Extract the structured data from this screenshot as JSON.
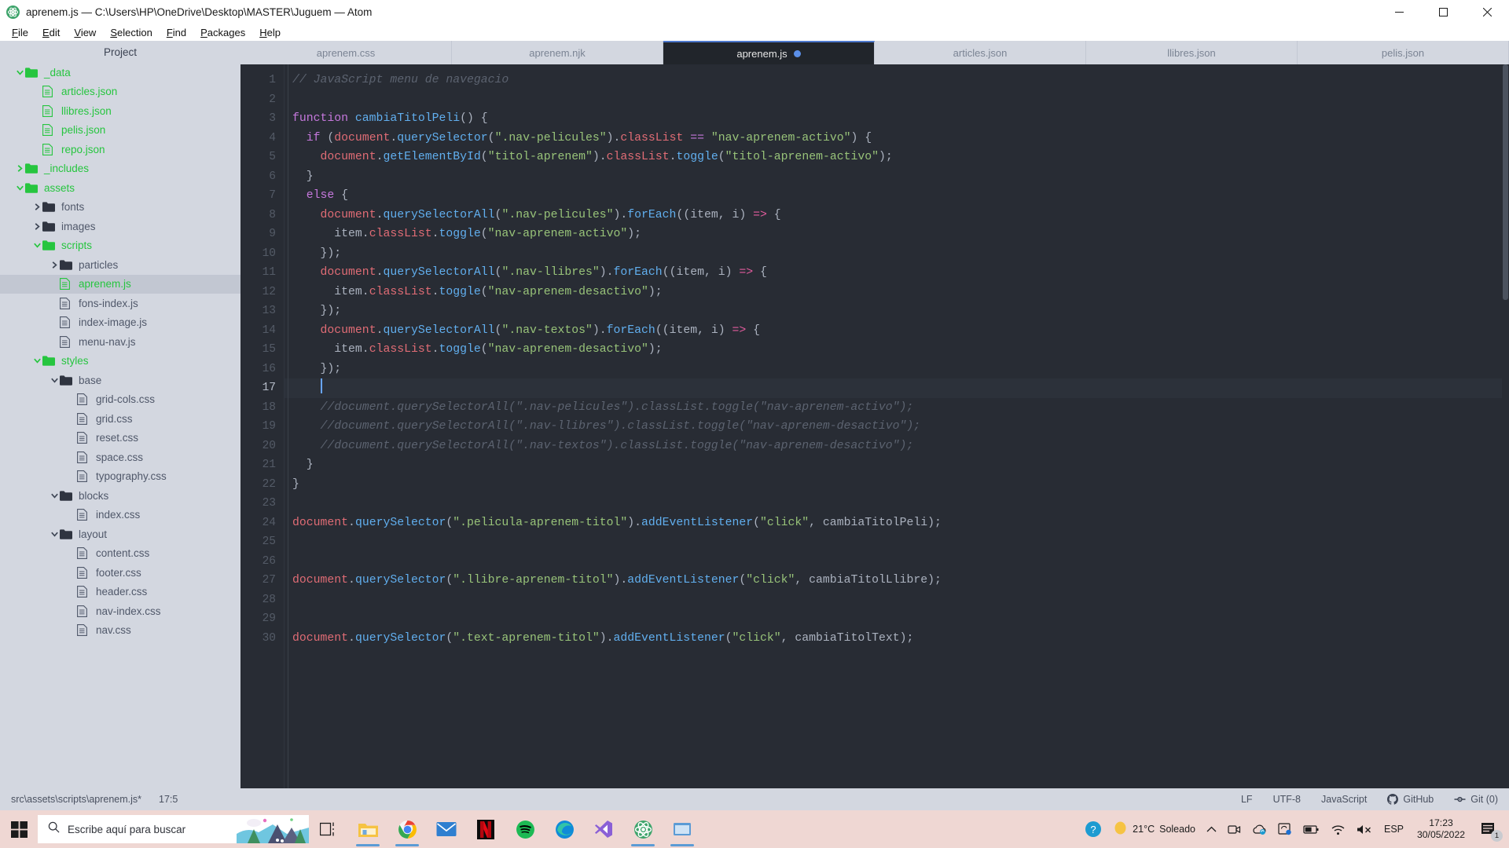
{
  "window": {
    "title": "aprenem.js — C:\\Users\\HP\\OneDrive\\Desktop\\MASTER\\Juguem — Atom",
    "app_icon": "atom-icon",
    "minimize_label": "Minimize",
    "maximize_label": "Maximize",
    "close_label": "Close"
  },
  "menubar": {
    "items": [
      {
        "label": "File"
      },
      {
        "label": "Edit"
      },
      {
        "label": "View"
      },
      {
        "label": "Selection"
      },
      {
        "label": "Find"
      },
      {
        "label": "Packages"
      },
      {
        "label": "Help"
      }
    ]
  },
  "sidebar": {
    "title": "Project",
    "tree": [
      {
        "label": "_data",
        "type": "folder",
        "state": "open",
        "depth": 1,
        "modified": true,
        "selected": false
      },
      {
        "label": "articles.json",
        "type": "file",
        "state": "none",
        "depth": 2,
        "modified": true,
        "selected": false
      },
      {
        "label": "llibres.json",
        "type": "file",
        "state": "none",
        "depth": 2,
        "modified": true,
        "selected": false
      },
      {
        "label": "pelis.json",
        "type": "file",
        "state": "none",
        "depth": 2,
        "modified": true,
        "selected": false
      },
      {
        "label": "repo.json",
        "type": "file",
        "state": "none",
        "depth": 2,
        "modified": true,
        "selected": false
      },
      {
        "label": "_includes",
        "type": "folder",
        "state": "closed",
        "depth": 1,
        "modified": true,
        "selected": false
      },
      {
        "label": "assets",
        "type": "folder",
        "state": "open",
        "depth": 1,
        "modified": true,
        "selected": false
      },
      {
        "label": "fonts",
        "type": "folder",
        "state": "closed",
        "depth": 2,
        "modified": false,
        "selected": false
      },
      {
        "label": "images",
        "type": "folder",
        "state": "closed",
        "depth": 2,
        "modified": false,
        "selected": false
      },
      {
        "label": "scripts",
        "type": "folder",
        "state": "open",
        "depth": 2,
        "modified": true,
        "selected": false
      },
      {
        "label": "particles",
        "type": "folder",
        "state": "closed",
        "depth": 3,
        "modified": false,
        "selected": false
      },
      {
        "label": "aprenem.js",
        "type": "file",
        "state": "none",
        "depth": 3,
        "modified": true,
        "selected": true
      },
      {
        "label": "fons-index.js",
        "type": "file",
        "state": "none",
        "depth": 3,
        "modified": false,
        "selected": false
      },
      {
        "label": "index-image.js",
        "type": "file",
        "state": "none",
        "depth": 3,
        "modified": false,
        "selected": false
      },
      {
        "label": "menu-nav.js",
        "type": "file",
        "state": "none",
        "depth": 3,
        "modified": false,
        "selected": false
      },
      {
        "label": "styles",
        "type": "folder",
        "state": "open",
        "depth": 2,
        "modified": true,
        "selected": false
      },
      {
        "label": "base",
        "type": "folder",
        "state": "open",
        "depth": 3,
        "modified": false,
        "selected": false
      },
      {
        "label": "grid-cols.css",
        "type": "file",
        "state": "none",
        "depth": 4,
        "modified": false,
        "selected": false
      },
      {
        "label": "grid.css",
        "type": "file",
        "state": "none",
        "depth": 4,
        "modified": false,
        "selected": false
      },
      {
        "label": "reset.css",
        "type": "file",
        "state": "none",
        "depth": 4,
        "modified": false,
        "selected": false
      },
      {
        "label": "space.css",
        "type": "file",
        "state": "none",
        "depth": 4,
        "modified": false,
        "selected": false
      },
      {
        "label": "typography.css",
        "type": "file",
        "state": "none",
        "depth": 4,
        "modified": false,
        "selected": false
      },
      {
        "label": "blocks",
        "type": "folder",
        "state": "open",
        "depth": 3,
        "modified": false,
        "selected": false
      },
      {
        "label": "index.css",
        "type": "file",
        "state": "none",
        "depth": 4,
        "modified": false,
        "selected": false
      },
      {
        "label": "layout",
        "type": "folder",
        "state": "open",
        "depth": 3,
        "modified": false,
        "selected": false
      },
      {
        "label": "content.css",
        "type": "file",
        "state": "none",
        "depth": 4,
        "modified": false,
        "selected": false
      },
      {
        "label": "footer.css",
        "type": "file",
        "state": "none",
        "depth": 4,
        "modified": false,
        "selected": false
      },
      {
        "label": "header.css",
        "type": "file",
        "state": "none",
        "depth": 4,
        "modified": false,
        "selected": false
      },
      {
        "label": "nav-index.css",
        "type": "file",
        "state": "none",
        "depth": 4,
        "modified": false,
        "selected": false
      },
      {
        "label": "nav.css",
        "type": "file",
        "state": "none",
        "depth": 4,
        "modified": false,
        "selected": false
      }
    ]
  },
  "tabs": [
    {
      "label": "aprenem.css",
      "active": false,
      "modified": false
    },
    {
      "label": "aprenem.njk",
      "active": false,
      "modified": false
    },
    {
      "label": "aprenem.js",
      "active": true,
      "modified": true
    },
    {
      "label": "articles.json",
      "active": false,
      "modified": false
    },
    {
      "label": "llibres.json",
      "active": false,
      "modified": false
    },
    {
      "label": "pelis.json",
      "active": false,
      "modified": false
    }
  ],
  "editor": {
    "cursor_line": 17,
    "lines": [
      {
        "n": 1,
        "tokens": [
          {
            "t": "// JavaScript menu de navegacio",
            "c": "cm"
          }
        ]
      },
      {
        "n": 2,
        "tokens": []
      },
      {
        "n": 3,
        "tokens": [
          {
            "t": "function ",
            "c": "k"
          },
          {
            "t": "cambiaTitolPeli",
            "c": "fn"
          },
          {
            "t": "() {",
            "c": "pn"
          }
        ]
      },
      {
        "n": 4,
        "tokens": [
          {
            "t": "  ",
            "c": "pn"
          },
          {
            "t": "if",
            "c": "k"
          },
          {
            "t": " (",
            "c": "pn"
          },
          {
            "t": "document",
            "c": "va"
          },
          {
            "t": ".",
            "c": "pn"
          },
          {
            "t": "querySelector",
            "c": "fn"
          },
          {
            "t": "(",
            "c": "pn"
          },
          {
            "t": "\".nav-pelicules\"",
            "c": "st"
          },
          {
            "t": ").",
            "c": "pn"
          },
          {
            "t": "classList",
            "c": "va"
          },
          {
            "t": " ",
            "c": "pn"
          },
          {
            "t": "==",
            "c": "op"
          },
          {
            "t": " ",
            "c": "pn"
          },
          {
            "t": "\"nav-aprenem-activo\"",
            "c": "st"
          },
          {
            "t": ") {",
            "c": "pn"
          }
        ]
      },
      {
        "n": 5,
        "tokens": [
          {
            "t": "    ",
            "c": "pn"
          },
          {
            "t": "document",
            "c": "va"
          },
          {
            "t": ".",
            "c": "pn"
          },
          {
            "t": "getElementById",
            "c": "fn"
          },
          {
            "t": "(",
            "c": "pn"
          },
          {
            "t": "\"titol-aprenem\"",
            "c": "st"
          },
          {
            "t": ").",
            "c": "pn"
          },
          {
            "t": "classList",
            "c": "va"
          },
          {
            "t": ".",
            "c": "pn"
          },
          {
            "t": "toggle",
            "c": "fn"
          },
          {
            "t": "(",
            "c": "pn"
          },
          {
            "t": "\"titol-aprenem-activo\"",
            "c": "st"
          },
          {
            "t": ");",
            "c": "pn"
          }
        ]
      },
      {
        "n": 6,
        "tokens": [
          {
            "t": "  }",
            "c": "pn"
          }
        ]
      },
      {
        "n": 7,
        "tokens": [
          {
            "t": "  ",
            "c": "pn"
          },
          {
            "t": "else",
            "c": "k"
          },
          {
            "t": " {",
            "c": "pn"
          }
        ]
      },
      {
        "n": 8,
        "tokens": [
          {
            "t": "    ",
            "c": "pn"
          },
          {
            "t": "document",
            "c": "va"
          },
          {
            "t": ".",
            "c": "pn"
          },
          {
            "t": "querySelectorAll",
            "c": "fn"
          },
          {
            "t": "(",
            "c": "pn"
          },
          {
            "t": "\".nav-pelicules\"",
            "c": "st"
          },
          {
            "t": ").",
            "c": "pn"
          },
          {
            "t": "forEach",
            "c": "fn"
          },
          {
            "t": "((item, i) ",
            "c": "pn"
          },
          {
            "t": "=>",
            "c": "ar"
          },
          {
            "t": " {",
            "c": "pn"
          }
        ]
      },
      {
        "n": 9,
        "tokens": [
          {
            "t": "      item",
            "c": "pn"
          },
          {
            "t": ".",
            "c": "pn"
          },
          {
            "t": "classList",
            "c": "va"
          },
          {
            "t": ".",
            "c": "pn"
          },
          {
            "t": "toggle",
            "c": "fn"
          },
          {
            "t": "(",
            "c": "pn"
          },
          {
            "t": "\"nav-aprenem-activo\"",
            "c": "st"
          },
          {
            "t": ");",
            "c": "pn"
          }
        ]
      },
      {
        "n": 10,
        "tokens": [
          {
            "t": "    });",
            "c": "pn"
          }
        ]
      },
      {
        "n": 11,
        "tokens": [
          {
            "t": "    ",
            "c": "pn"
          },
          {
            "t": "document",
            "c": "va"
          },
          {
            "t": ".",
            "c": "pn"
          },
          {
            "t": "querySelectorAll",
            "c": "fn"
          },
          {
            "t": "(",
            "c": "pn"
          },
          {
            "t": "\".nav-llibres\"",
            "c": "st"
          },
          {
            "t": ").",
            "c": "pn"
          },
          {
            "t": "forEach",
            "c": "fn"
          },
          {
            "t": "((item, i) ",
            "c": "pn"
          },
          {
            "t": "=>",
            "c": "ar"
          },
          {
            "t": " {",
            "c": "pn"
          }
        ]
      },
      {
        "n": 12,
        "tokens": [
          {
            "t": "      item",
            "c": "pn"
          },
          {
            "t": ".",
            "c": "pn"
          },
          {
            "t": "classList",
            "c": "va"
          },
          {
            "t": ".",
            "c": "pn"
          },
          {
            "t": "toggle",
            "c": "fn"
          },
          {
            "t": "(",
            "c": "pn"
          },
          {
            "t": "\"nav-aprenem-desactivo\"",
            "c": "st"
          },
          {
            "t": ");",
            "c": "pn"
          }
        ]
      },
      {
        "n": 13,
        "tokens": [
          {
            "t": "    });",
            "c": "pn"
          }
        ]
      },
      {
        "n": 14,
        "tokens": [
          {
            "t": "    ",
            "c": "pn"
          },
          {
            "t": "document",
            "c": "va"
          },
          {
            "t": ".",
            "c": "pn"
          },
          {
            "t": "querySelectorAll",
            "c": "fn"
          },
          {
            "t": "(",
            "c": "pn"
          },
          {
            "t": "\".nav-textos\"",
            "c": "st"
          },
          {
            "t": ").",
            "c": "pn"
          },
          {
            "t": "forEach",
            "c": "fn"
          },
          {
            "t": "((item, i) ",
            "c": "pn"
          },
          {
            "t": "=>",
            "c": "ar"
          },
          {
            "t": " {",
            "c": "pn"
          }
        ]
      },
      {
        "n": 15,
        "tokens": [
          {
            "t": "      item",
            "c": "pn"
          },
          {
            "t": ".",
            "c": "pn"
          },
          {
            "t": "classList",
            "c": "va"
          },
          {
            "t": ".",
            "c": "pn"
          },
          {
            "t": "toggle",
            "c": "fn"
          },
          {
            "t": "(",
            "c": "pn"
          },
          {
            "t": "\"nav-aprenem-desactivo\"",
            "c": "st"
          },
          {
            "t": ");",
            "c": "pn"
          }
        ]
      },
      {
        "n": 16,
        "tokens": [
          {
            "t": "    });",
            "c": "pn"
          }
        ]
      },
      {
        "n": 17,
        "tokens": [
          {
            "t": "    ",
            "c": "pn"
          }
        ],
        "cursor": true
      },
      {
        "n": 18,
        "tokens": [
          {
            "t": "    //document.querySelectorAll(\".nav-pelicules\").classList.toggle(\"nav-aprenem-activo\");",
            "c": "cm"
          }
        ]
      },
      {
        "n": 19,
        "tokens": [
          {
            "t": "    //document.querySelectorAll(\".nav-llibres\").classList.toggle(\"nav-aprenem-desactivo\");",
            "c": "cm"
          }
        ]
      },
      {
        "n": 20,
        "tokens": [
          {
            "t": "    //document.querySelectorAll(\".nav-textos\").classList.toggle(\"nav-aprenem-desactivo\");",
            "c": "cm"
          }
        ]
      },
      {
        "n": 21,
        "tokens": [
          {
            "t": "  }",
            "c": "pn"
          }
        ]
      },
      {
        "n": 22,
        "tokens": [
          {
            "t": "}",
            "c": "pn"
          }
        ]
      },
      {
        "n": 23,
        "tokens": []
      },
      {
        "n": 24,
        "tokens": [
          {
            "t": "document",
            "c": "va"
          },
          {
            "t": ".",
            "c": "pn"
          },
          {
            "t": "querySelector",
            "c": "fn"
          },
          {
            "t": "(",
            "c": "pn"
          },
          {
            "t": "\".pelicula-aprenem-titol\"",
            "c": "st"
          },
          {
            "t": ").",
            "c": "pn"
          },
          {
            "t": "addEventListener",
            "c": "fn"
          },
          {
            "t": "(",
            "c": "pn"
          },
          {
            "t": "\"click\"",
            "c": "st"
          },
          {
            "t": ", cambiaTitolPeli);",
            "c": "pn"
          }
        ]
      },
      {
        "n": 25,
        "tokens": []
      },
      {
        "n": 26,
        "tokens": []
      },
      {
        "n": 27,
        "tokens": [
          {
            "t": "document",
            "c": "va"
          },
          {
            "t": ".",
            "c": "pn"
          },
          {
            "t": "querySelector",
            "c": "fn"
          },
          {
            "t": "(",
            "c": "pn"
          },
          {
            "t": "\".llibre-aprenem-titol\"",
            "c": "st"
          },
          {
            "t": ").",
            "c": "pn"
          },
          {
            "t": "addEventListener",
            "c": "fn"
          },
          {
            "t": "(",
            "c": "pn"
          },
          {
            "t": "\"click\"",
            "c": "st"
          },
          {
            "t": ", cambiaTitolLlibre);",
            "c": "pn"
          }
        ]
      },
      {
        "n": 28,
        "tokens": []
      },
      {
        "n": 29,
        "tokens": []
      },
      {
        "n": 30,
        "tokens": [
          {
            "t": "document",
            "c": "va"
          },
          {
            "t": ".",
            "c": "pn"
          },
          {
            "t": "querySelector",
            "c": "fn"
          },
          {
            "t": "(",
            "c": "pn"
          },
          {
            "t": "\".text-aprenem-titol\"",
            "c": "st"
          },
          {
            "t": ").",
            "c": "pn"
          },
          {
            "t": "addEventListener",
            "c": "fn"
          },
          {
            "t": "(",
            "c": "pn"
          },
          {
            "t": "\"click\"",
            "c": "st"
          },
          {
            "t": ", cambiaTitolText);",
            "c": "pn"
          }
        ]
      }
    ]
  },
  "statusbar": {
    "file_path": "src\\assets\\scripts\\aprenem.js*",
    "cursor_position": "17:5",
    "line_ending": "LF",
    "encoding": "UTF-8",
    "grammar": "JavaScript",
    "github": "GitHub",
    "git": "Git (0)"
  },
  "taskbar": {
    "search_placeholder": "Escribe aquí para buscar",
    "weather_temp": "21°C",
    "weather_desc": "Soleado",
    "language": "ESP",
    "time": "17:23",
    "date": "30/05/2022",
    "notification_count": "1",
    "apps": [
      {
        "name": "task-view",
        "active": false
      },
      {
        "name": "file-explorer",
        "active": true
      },
      {
        "name": "chrome",
        "active": true
      },
      {
        "name": "mail",
        "active": false
      },
      {
        "name": "netflix",
        "active": false
      },
      {
        "name": "spotify",
        "active": false
      },
      {
        "name": "edge",
        "active": false
      },
      {
        "name": "visual-studio",
        "active": false
      },
      {
        "name": "atom",
        "active": true
      },
      {
        "name": "explorer-2",
        "active": true
      }
    ]
  },
  "colors": {
    "accent": "#4d78cc",
    "editor_bg": "#282c34",
    "sidebar_bg": "#d3d7e0",
    "modified_green": "#26c53f",
    "taskbar_bg": "#efd7d3"
  }
}
